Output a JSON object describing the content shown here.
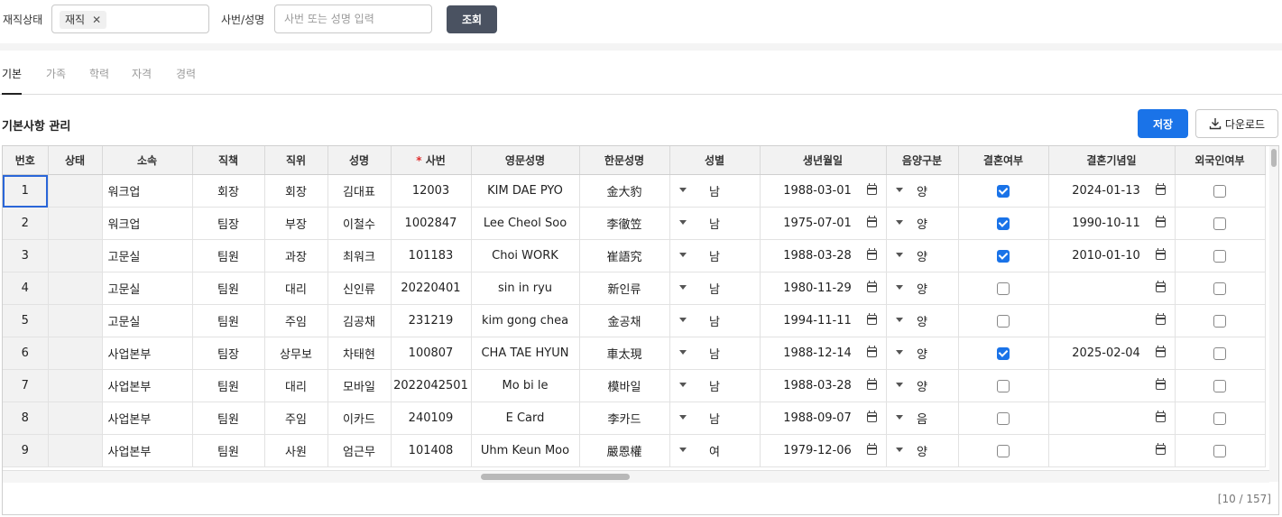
{
  "filters": {
    "status_label": "재직상태",
    "status_chip": "재직",
    "status_chip_remove": "✕",
    "search_label": "사번/성명",
    "search_placeholder": "사번 또는 성명 입력",
    "query_button": "조회"
  },
  "tabs": [
    "기본",
    "가족",
    "학력",
    "자격",
    "경력"
  ],
  "active_tab": "기본",
  "section_title": "기본사항 관리",
  "save_button": "저장",
  "download_button": "다운로드",
  "columns": [
    "번호",
    "상태",
    "소속",
    "직책",
    "직위",
    "성명",
    "* 사번",
    "영문성명",
    "한문성명",
    "성별",
    "생년월일",
    "음양구분",
    "결혼여부",
    "결혼기념일",
    "외국인여부"
  ],
  "column_parts": {
    "required_mark": "*",
    "sabun": "사번"
  },
  "rows": [
    {
      "no": "1",
      "status": "",
      "dept": "워크업",
      "duty": "회장",
      "rank": "회장",
      "name": "김대표",
      "id": "12003",
      "eng": "KIM DAE PYO",
      "hanja": "金大豹",
      "gender": "남",
      "birth": "1988-03-01",
      "lunar": "양",
      "married": true,
      "wedding": "2024-01-13",
      "foreign": false
    },
    {
      "no": "2",
      "status": "",
      "dept": "워크업",
      "duty": "팀장",
      "rank": "부장",
      "name": "이철수",
      "id": "1002847",
      "eng": "Lee Cheol Soo",
      "hanja": "李徹笠",
      "gender": "남",
      "birth": "1975-07-01",
      "lunar": "양",
      "married": true,
      "wedding": "1990-10-11",
      "foreign": false
    },
    {
      "no": "3",
      "status": "",
      "dept": "고문실",
      "duty": "팀원",
      "rank": "과장",
      "name": "최워크",
      "id": "101183",
      "eng": "Choi WORK",
      "hanja": "崔語究",
      "gender": "남",
      "birth": "1988-03-28",
      "lunar": "양",
      "married": true,
      "wedding": "2010-01-10",
      "foreign": false
    },
    {
      "no": "4",
      "status": "",
      "dept": "고문실",
      "duty": "팀원",
      "rank": "대리",
      "name": "신인류",
      "id": "20220401",
      "eng": "sin in ryu",
      "hanja": "新인류",
      "gender": "남",
      "birth": "1980-11-29",
      "lunar": "양",
      "married": false,
      "wedding": "",
      "foreign": false
    },
    {
      "no": "5",
      "status": "",
      "dept": "고문실",
      "duty": "팀원",
      "rank": "주임",
      "name": "김공채",
      "id": "231219",
      "eng": "kim gong chea",
      "hanja": "金공채",
      "gender": "남",
      "birth": "1994-11-11",
      "lunar": "양",
      "married": false,
      "wedding": "",
      "foreign": false
    },
    {
      "no": "6",
      "status": "",
      "dept": "사업본부",
      "duty": "팀장",
      "rank": "상무보",
      "name": "차태현",
      "id": "100807",
      "eng": "CHA TAE HYUN",
      "hanja": "車太現",
      "gender": "남",
      "birth": "1988-12-14",
      "lunar": "양",
      "married": true,
      "wedding": "2025-02-04",
      "foreign": false
    },
    {
      "no": "7",
      "status": "",
      "dept": "사업본부",
      "duty": "팀원",
      "rank": "대리",
      "name": "모바일",
      "id": "2022042501",
      "eng": "Mo bi le",
      "hanja": "模바일",
      "gender": "남",
      "birth": "1988-03-28",
      "lunar": "양",
      "married": false,
      "wedding": "",
      "foreign": false
    },
    {
      "no": "8",
      "status": "",
      "dept": "사업본부",
      "duty": "팀원",
      "rank": "주임",
      "name": "이카드",
      "id": "240109",
      "eng": "E Card",
      "hanja": "李카드",
      "gender": "남",
      "birth": "1988-09-07",
      "lunar": "음",
      "married": false,
      "wedding": "",
      "foreign": false
    },
    {
      "no": "9",
      "status": "",
      "dept": "사업본부",
      "duty": "팀원",
      "rank": "사원",
      "name": "엄근무",
      "id": "101408",
      "eng": "Uhm Keun Moo",
      "hanja": "嚴恩權",
      "gender": "여",
      "birth": "1979-12-06",
      "lunar": "양",
      "married": false,
      "wedding": "",
      "foreign": false
    }
  ],
  "pager": "[10 / 157]",
  "colors": {
    "primary": "#1a73e8",
    "query": "#4a5261",
    "selected_border": "#2a66d8"
  }
}
